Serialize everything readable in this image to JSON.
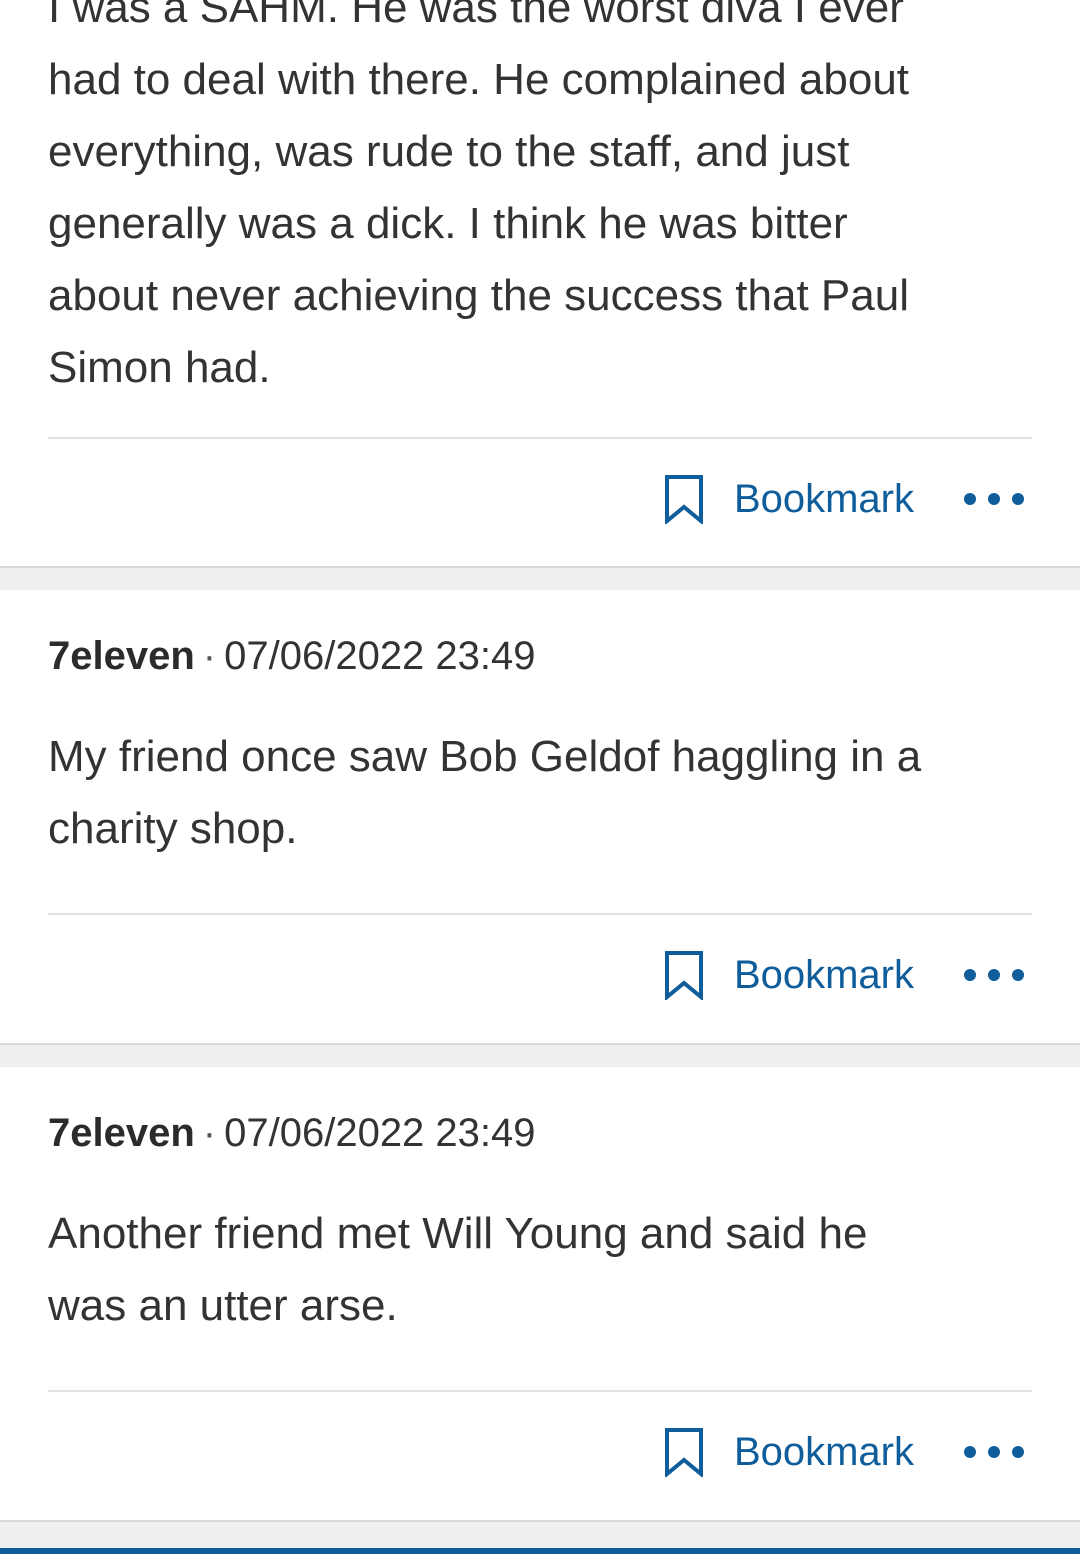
{
  "posts": [
    {
      "author": "",
      "timestamp": "",
      "body_lines": [
        "I was a SAHM. He was the worst diva I ever",
        "had to deal with there. He complained about",
        "everything, was rude to the staff, and just",
        "generally was a dick. I think he was bitter",
        "about never achieving the success that Paul",
        "Simon had."
      ],
      "bookmark_label": "Bookmark"
    },
    {
      "author": "7eleven",
      "separator": "·",
      "timestamp": "07/06/2022 23:49",
      "body_lines": [
        "My friend once saw Bob Geldof haggling in a",
        "charity shop."
      ],
      "bookmark_label": "Bookmark"
    },
    {
      "author": "7eleven",
      "separator": "·",
      "timestamp": "07/06/2022 23:49",
      "body_lines": [
        "Another friend met Will Young and said he",
        "was an utter arse."
      ],
      "bookmark_label": "Bookmark"
    }
  ],
  "icons": {
    "bookmark": "bookmark-icon",
    "more": "more-options-icon"
  },
  "colors": {
    "link": "#0f5d9a",
    "text": "#333333",
    "separator_band": "#efefef"
  }
}
